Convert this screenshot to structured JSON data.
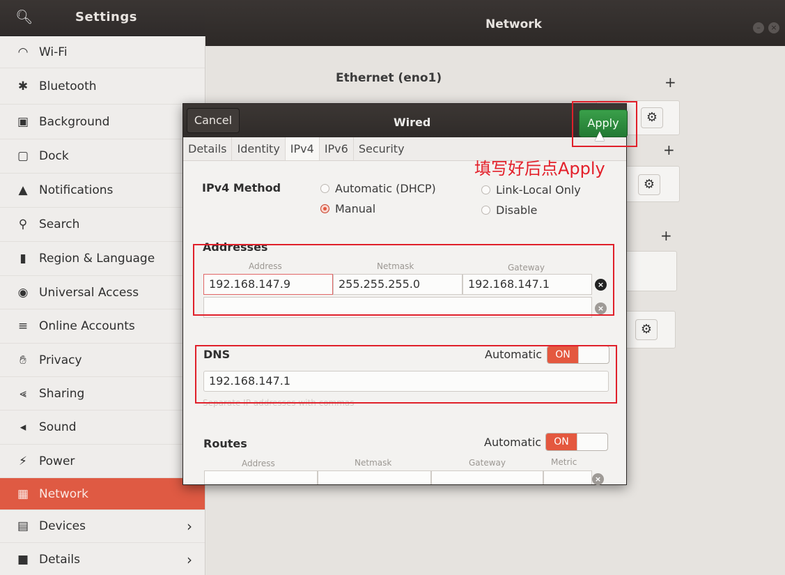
{
  "sidebar_header": {
    "title": "Settings",
    "search_icon": "search-icon"
  },
  "main_header": {
    "title": "Network"
  },
  "sidebar": {
    "items": [
      {
        "label": "Wi-Fi",
        "icon": "wifi-icon"
      },
      {
        "label": "Bluetooth",
        "icon": "bluetooth-icon"
      },
      {
        "label": "Background",
        "icon": "display-icon"
      },
      {
        "label": "Dock",
        "icon": "dock-icon"
      },
      {
        "label": "Notifications",
        "icon": "bell-icon"
      },
      {
        "label": "Search",
        "icon": "search-icon"
      },
      {
        "label": "Region & Language",
        "icon": "camera-icon"
      },
      {
        "label": "Universal Access",
        "icon": "accessibility-icon"
      },
      {
        "label": "Online Accounts",
        "icon": "online-accounts-icon"
      },
      {
        "label": "Privacy",
        "icon": "hand-icon"
      },
      {
        "label": "Sharing",
        "icon": "share-icon"
      },
      {
        "label": "Sound",
        "icon": "speaker-icon"
      },
      {
        "label": "Power",
        "icon": "power-icon"
      },
      {
        "label": "Network",
        "icon": "network-icon",
        "active": true
      },
      {
        "label": "Devices",
        "icon": "devices-icon",
        "chevron": true
      },
      {
        "label": "Details",
        "icon": "info-icon",
        "chevron": true
      }
    ]
  },
  "main": {
    "ethernet_title": "Ethernet (eno1)"
  },
  "dialog": {
    "title": "Wired",
    "cancel_label": "Cancel",
    "apply_label": "Apply",
    "tabs": [
      "Details",
      "Identity",
      "IPv4",
      "IPv6",
      "Security"
    ],
    "active_tab": "IPv4",
    "ipv4_method": {
      "label": "IPv4 Method",
      "options": {
        "dhcp": "Automatic (DHCP)",
        "link_local": "Link-Local Only",
        "manual": "Manual",
        "disable": "Disable"
      },
      "selected": "Manual"
    },
    "addresses": {
      "label": "Addresses",
      "col_address": "Address",
      "col_netmask": "Netmask",
      "col_gateway": "Gateway",
      "address": "192.168.147.9",
      "netmask": "255.255.255.0",
      "gateway": "192.168.147.1"
    },
    "dns": {
      "label": "DNS",
      "automatic_label": "Automatic",
      "toggle": "ON",
      "value": "192.168.147.1",
      "hint": "Separate IP addresses with commas"
    },
    "routes": {
      "label": "Routes",
      "automatic_label": "Automatic",
      "toggle": "ON",
      "col_address": "Address",
      "col_netmask": "Netmask",
      "col_gateway": "Gateway",
      "col_metric": "Metric"
    }
  },
  "annotation": {
    "text": "填写好后点Apply",
    "color": "#e3212b"
  },
  "colors": {
    "accent": "#df5a43",
    "apply_green": "#2e8c3e",
    "toggle_on": "#e4583f"
  }
}
